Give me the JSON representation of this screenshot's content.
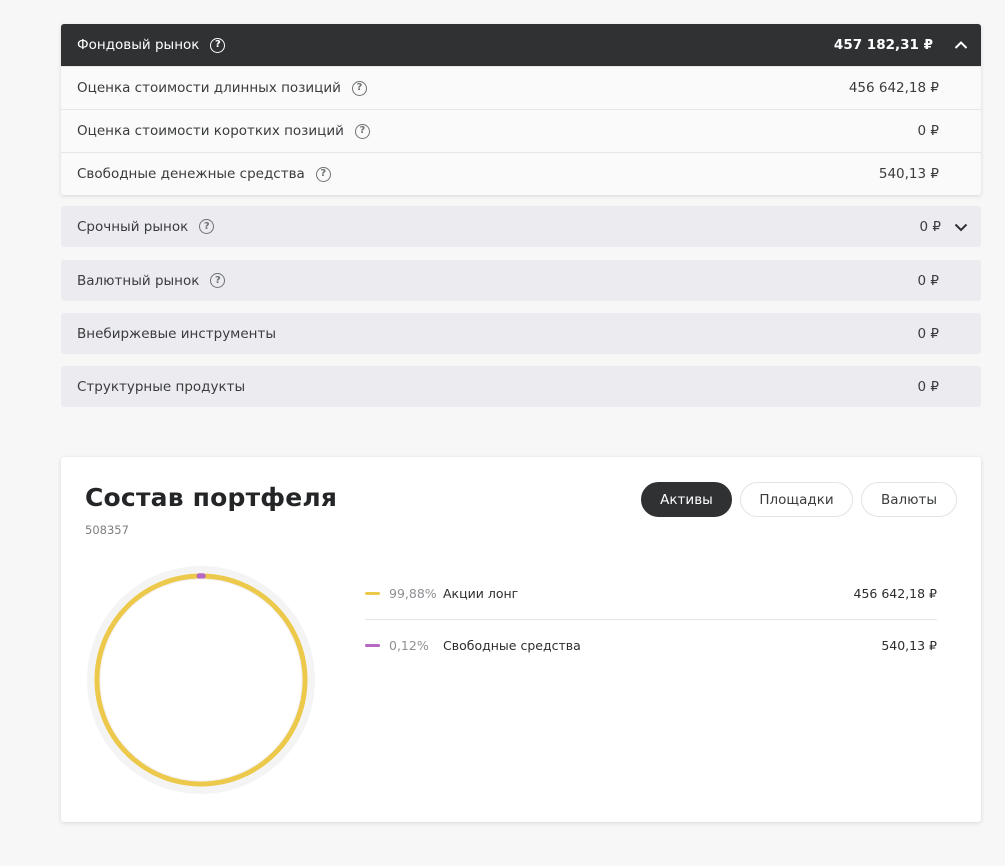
{
  "markets": {
    "stock": {
      "label": "Фондовый рынок",
      "amount": "457 182,31 ₽",
      "rows": [
        {
          "label": "Оценка стоимости длинных позиций",
          "amount": "456 642,18 ₽"
        },
        {
          "label": "Оценка стоимости коротких позиций",
          "amount": "0 ₽"
        },
        {
          "label": "Свободные денежные средства",
          "amount": "540,13 ₽"
        }
      ]
    },
    "derivatives": {
      "label": "Срочный рынок",
      "amount": "0 ₽"
    },
    "currency": {
      "label": "Валютный рынок",
      "amount": "0 ₽"
    },
    "otc": {
      "label": "Внебиржевые инструменты",
      "amount": "0 ₽"
    },
    "structured": {
      "label": "Структурные продукты",
      "amount": "0 ₽"
    }
  },
  "portfolio": {
    "title": "Состав портфеля",
    "account": "508357",
    "tabs": [
      "Активы",
      "Площадки",
      "Валюты"
    ],
    "active_tab": "Активы",
    "legend": [
      {
        "pct": "99,88%",
        "name": "Акции лонг",
        "value": "456 642,18 ₽",
        "color": "#ecc94b",
        "share": 0.9988
      },
      {
        "pct": "0,12%",
        "name": "Свободные средства",
        "value": "540,13 ₽",
        "color": "#b667c4",
        "share": 0.0012
      }
    ]
  },
  "icons": {
    "help": "question-circle-icon",
    "collapse": "chevron-up-icon",
    "expand": "chevron-down-icon"
  }
}
